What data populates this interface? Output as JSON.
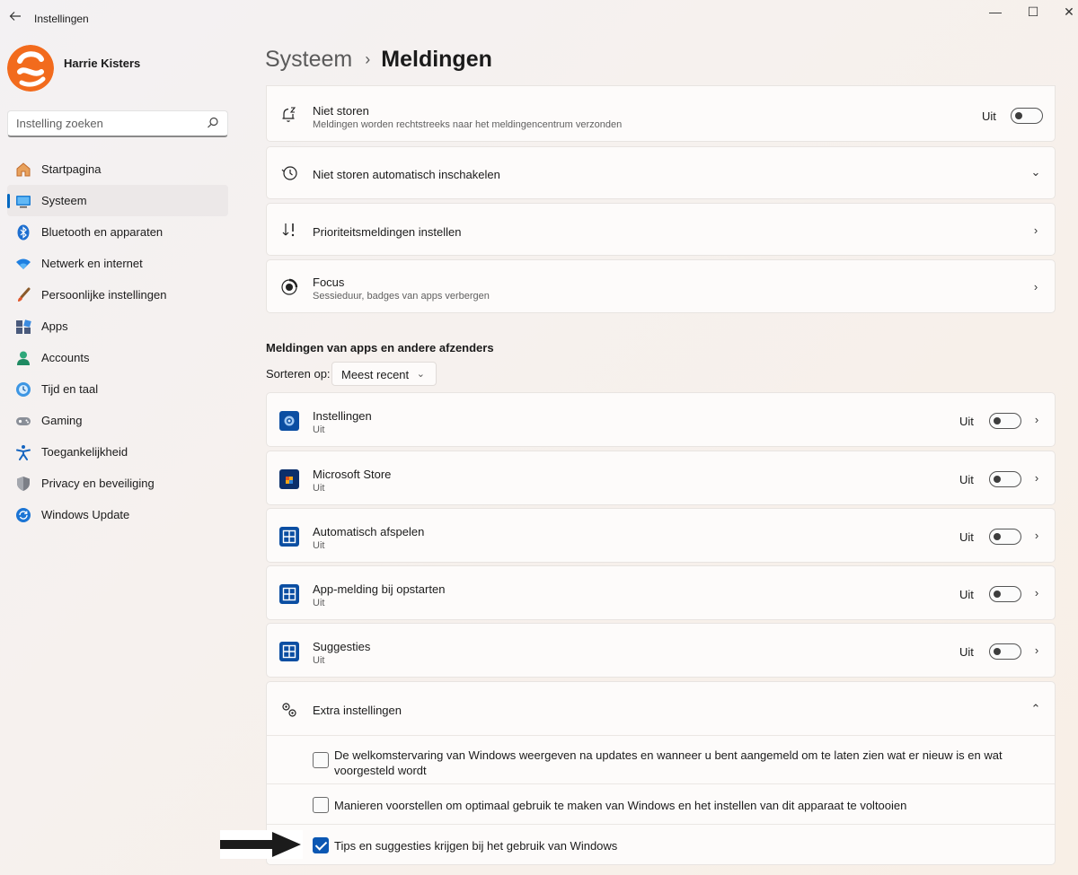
{
  "window": {
    "title": "Instellingen",
    "back_icon": "back-arrow-icon",
    "min_glyph": "—",
    "max_glyph": "☐",
    "close_glyph": "✕"
  },
  "profile": {
    "name": "Harrie Kisters"
  },
  "search": {
    "placeholder": "Instelling zoeken",
    "value": ""
  },
  "sidebar": {
    "items": [
      {
        "label": "Startpagina",
        "icon": "home-icon"
      },
      {
        "label": "Systeem",
        "icon": "system-icon",
        "active": true
      },
      {
        "label": "Bluetooth en apparaten",
        "icon": "bluetooth-icon"
      },
      {
        "label": "Netwerk en internet",
        "icon": "network-icon"
      },
      {
        "label": "Persoonlijke instellingen",
        "icon": "brush-icon"
      },
      {
        "label": "Apps",
        "icon": "apps-icon"
      },
      {
        "label": "Accounts",
        "icon": "accounts-icon"
      },
      {
        "label": "Tijd en taal",
        "icon": "time-language-icon"
      },
      {
        "label": "Gaming",
        "icon": "gaming-icon"
      },
      {
        "label": "Toegankelijkheid",
        "icon": "accessibility-icon"
      },
      {
        "label": "Privacy en beveiliging",
        "icon": "shield-icon"
      },
      {
        "label": "Windows Update",
        "icon": "update-icon"
      }
    ]
  },
  "breadcrumb": {
    "parent": "Systeem",
    "separator": "›",
    "current": "Meldingen"
  },
  "top_cards": {
    "dnd": {
      "title": "Niet storen",
      "subtitle": "Meldingen worden rechtstreeks naar het meldingencentrum verzonden",
      "toggle_label": "Uit",
      "toggle_on": false
    },
    "dnd_auto": {
      "title": "Niet storen automatisch inschakelen",
      "chevron": "⌄"
    },
    "priority": {
      "title": "Prioriteitsmeldingen instellen",
      "chevron": "›"
    },
    "focus": {
      "title": "Focus",
      "subtitle": "Sessieduur, badges van apps verbergen",
      "chevron": "›"
    }
  },
  "apps_section": {
    "title": "Meldingen van apps en andere afzenders",
    "sort_label": "Sorteren op:",
    "sort_value": "Meest recent",
    "sort_chevron": "⌄",
    "apps": [
      {
        "name": "Instellingen",
        "status": "Uit",
        "toggle_label": "Uit",
        "toggle_on": false,
        "icon": "settings-app-icon"
      },
      {
        "name": "Microsoft Store",
        "status": "Uit",
        "toggle_label": "Uit",
        "toggle_on": false,
        "icon": "store-app-icon"
      },
      {
        "name": "Automatisch afspelen",
        "status": "Uit",
        "toggle_label": "Uit",
        "toggle_on": false,
        "icon": "autoplay-app-icon"
      },
      {
        "name": "App-melding bij opstarten",
        "status": "Uit",
        "toggle_label": "Uit",
        "toggle_on": false,
        "icon": "startup-app-icon"
      },
      {
        "name": "Suggesties",
        "status": "Uit",
        "toggle_label": "Uit",
        "toggle_on": false,
        "icon": "suggestions-app-icon"
      }
    ],
    "row_chevron": "›"
  },
  "extra": {
    "title": "Extra instellingen",
    "chevron": "⌃",
    "options": [
      {
        "label": "De welkomstervaring van Windows weergeven na updates en wanneer u bent aangemeld om te laten zien wat er nieuw is en wat voorgesteld wordt",
        "checked": false
      },
      {
        "label": "Manieren voorstellen om optimaal gebruik te maken van Windows en het instellen van dit apparaat te voltooien",
        "checked": false
      },
      {
        "label": "Tips en suggesties krijgen bij het gebruik van Windows",
        "checked": true
      }
    ]
  },
  "colors": {
    "accent": "#0067c0",
    "checkbox_checked": "#0b57b3",
    "app_icon_bg": "#0b4ea2"
  }
}
